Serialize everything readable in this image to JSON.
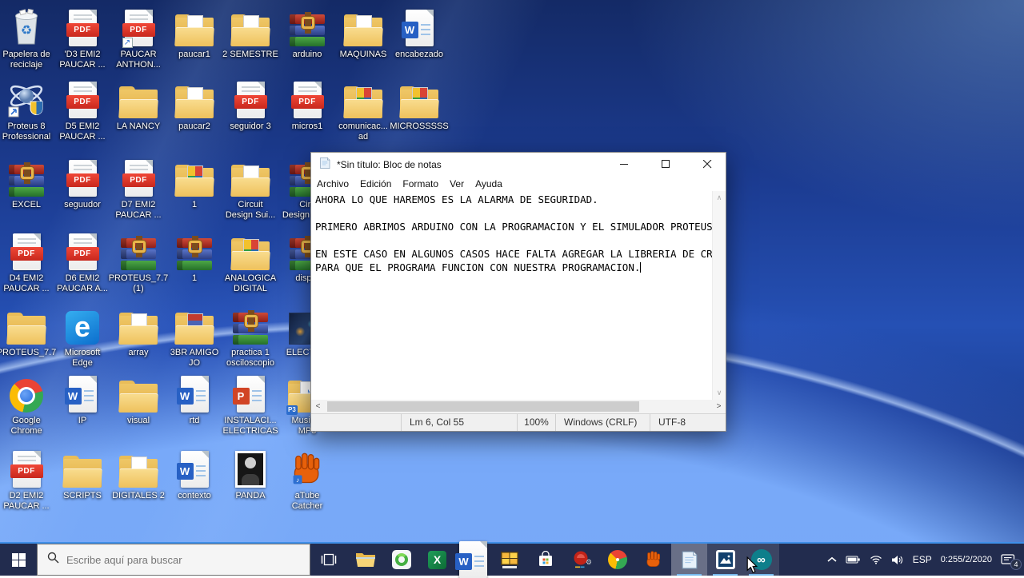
{
  "desktop": {
    "icons": [
      {
        "label": "Papelera de\nreciclaje",
        "icon": "recycle-bin",
        "col": 1,
        "row": 1
      },
      {
        "label": "'D3 EMI2\nPAUCAR ...",
        "icon": "pdf",
        "col": 2,
        "row": 1
      },
      {
        "label": "PAUCAR\nANTHON...",
        "icon": "pdf-shortcut",
        "col": 3,
        "row": 1
      },
      {
        "label": "paucar1",
        "icon": "folder-doc",
        "col": 4,
        "row": 1
      },
      {
        "label": "2 SEMESTRE",
        "icon": "folder-doc",
        "col": 5,
        "row": 1
      },
      {
        "label": "arduino",
        "icon": "winrar",
        "col": 6,
        "row": 1
      },
      {
        "label": "MAQUINAS",
        "icon": "folder-doc",
        "col": 7,
        "row": 1
      },
      {
        "label": "encabezado",
        "icon": "word",
        "col": 8,
        "row": 1
      },
      {
        "label": "Proteus 8\nProfessional",
        "icon": "proteus",
        "col": 1,
        "row": 2
      },
      {
        "label": "D5 EMI2\nPAUCAR ...",
        "icon": "pdf",
        "col": 2,
        "row": 2
      },
      {
        "label": "LA NANCY",
        "icon": "folder",
        "col": 3,
        "row": 2
      },
      {
        "label": "paucar2",
        "icon": "folder-doc",
        "col": 4,
        "row": 2
      },
      {
        "label": "seguidor 3",
        "icon": "pdf",
        "col": 5,
        "row": 2
      },
      {
        "label": "micros1",
        "icon": "pdf",
        "col": 6,
        "row": 2
      },
      {
        "label": "comunicac...\nad",
        "icon": "folder-images",
        "col": 7,
        "row": 2
      },
      {
        "label": "MICROSSSSS",
        "icon": "folder-images",
        "col": 8,
        "row": 2
      },
      {
        "label": "EXCEL",
        "icon": "winrar",
        "col": 1,
        "row": 3
      },
      {
        "label": "seguudor",
        "icon": "pdf",
        "col": 2,
        "row": 3
      },
      {
        "label": "D7 EMI2\nPAUCAR ...",
        "icon": "pdf",
        "col": 3,
        "row": 3
      },
      {
        "label": "1",
        "icon": "folder-images",
        "col": 4,
        "row": 3
      },
      {
        "label": "Circuit\nDesign Sui...",
        "icon": "folder-doc",
        "col": 5,
        "row": 3
      },
      {
        "label": "Circ\nDesign Sui...",
        "icon": "winrar",
        "col": 6,
        "row": 3
      },
      {
        "label": "D4 EMI2\nPAUCAR ...",
        "icon": "pdf",
        "col": 1,
        "row": 4
      },
      {
        "label": "D6 EMI2\nPAUCAR A...",
        "icon": "pdf",
        "col": 2,
        "row": 4
      },
      {
        "label": "PROTEUS_7.7\n(1)",
        "icon": "winrar",
        "col": 3,
        "row": 4
      },
      {
        "label": "1",
        "icon": "winrar",
        "col": 4,
        "row": 4
      },
      {
        "label": "ANALOGICA\nDIGITAL",
        "icon": "folder-images",
        "col": 5,
        "row": 4
      },
      {
        "label": "disp...",
        "icon": "winrar",
        "col": 6,
        "row": 4
      },
      {
        "label": "PROTEUS_7.7",
        "icon": "folder",
        "col": 1,
        "row": 5
      },
      {
        "label": "Microsoft\nEdge",
        "icon": "edge",
        "col": 2,
        "row": 5
      },
      {
        "label": "array",
        "icon": "folder-doc",
        "col": 3,
        "row": 5
      },
      {
        "label": "3BR AMIGO\nJO",
        "icon": "folder-rar",
        "col": 4,
        "row": 5
      },
      {
        "label": "practica 1\nosciloscopio",
        "icon": "winrar",
        "col": 5,
        "row": 5
      },
      {
        "label": "ELECTR...",
        "icon": "image-dark",
        "col": 6,
        "row": 5
      },
      {
        "label": "Google\nChrome",
        "icon": "chrome",
        "col": 1,
        "row": 6
      },
      {
        "label": "IP",
        "icon": "word",
        "col": 2,
        "row": 6
      },
      {
        "label": "visual",
        "icon": "folder",
        "col": 3,
        "row": 6
      },
      {
        "label": "rtd",
        "icon": "word",
        "col": 4,
        "row": 6
      },
      {
        "label": "INSTALACI...\nELECTRICAS",
        "icon": "powerpoint",
        "col": 5,
        "row": 6
      },
      {
        "label": "Music S\nMP3",
        "icon": "folder-music",
        "col": 6,
        "row": 6
      },
      {
        "label": "D2 EMI2\nPAUCAR ...",
        "icon": "pdf",
        "col": 1,
        "row": 7
      },
      {
        "label": "SCRIPTS",
        "icon": "folder",
        "col": 2,
        "row": 7
      },
      {
        "label": "DIGITALES 2",
        "icon": "folder-doc",
        "col": 3,
        "row": 7
      },
      {
        "label": "contexto",
        "icon": "word",
        "col": 4,
        "row": 7
      },
      {
        "label": "PANDA",
        "icon": "photo-person",
        "col": 5,
        "row": 7
      },
      {
        "label": "aTube\nCatcher",
        "icon": "atube-catcher",
        "col": 6,
        "row": 7
      }
    ]
  },
  "window": {
    "title": "*Sin título: Bloc de notas",
    "menu_items": [
      "Archivo",
      "Edición",
      "Formato",
      "Ver",
      "Ayuda"
    ],
    "content_lines": [
      "AHORA LO QUE HAREMOS ES LA ALARMA DE SEGURIDAD.",
      "",
      "PRIMERO ABRIMOS ARDUINO CON LA PROGRAMACION Y EL SIMULADOR PROTEUS",
      "",
      "EN ESTE CASO EN ALGUNOS CASOS HACE FALTA AGREGAR LA LIBRERIA DE CR",
      "PARA QUE EL PROGRAMA FUNCION CON NUESTRA PROGRAMACION."
    ],
    "status_items": [
      "Lm 6, Col 55",
      "100%",
      "Windows (CRLF)",
      "UTF-8"
    ]
  },
  "taskbar": {
    "search_placeholder": "Escribe aquí para buscar",
    "apps": [
      {
        "icon": "file-explorer",
        "state": "pinned"
      },
      {
        "icon": "green-app",
        "state": "pinned"
      },
      {
        "icon": "excel",
        "state": "pinned"
      },
      {
        "icon": "word",
        "state": "pinned"
      },
      {
        "icon": "yellow-grid-app",
        "state": "pinned"
      },
      {
        "icon": "microsoft-store",
        "state": "pinned"
      },
      {
        "icon": "red-app",
        "state": "pinned"
      },
      {
        "icon": "chrome",
        "state": "pinned"
      },
      {
        "icon": "atube-catcher",
        "state": "pinned"
      },
      {
        "icon": "notepad",
        "state": "active"
      },
      {
        "icon": "photos",
        "state": "running"
      },
      {
        "icon": "arduino",
        "state": "running"
      }
    ],
    "tray": {
      "language": "ESP",
      "time": "0:25",
      "date": "5/2/2020",
      "notification_badge": "4"
    }
  },
  "icon_letters": {
    "pdf": "PDF",
    "word": "W",
    "powerpoint": "P",
    "edge": "e",
    "arduino": "∞",
    "music_note": "♪",
    "recycle": "♻",
    "p3_badge": "P3"
  }
}
